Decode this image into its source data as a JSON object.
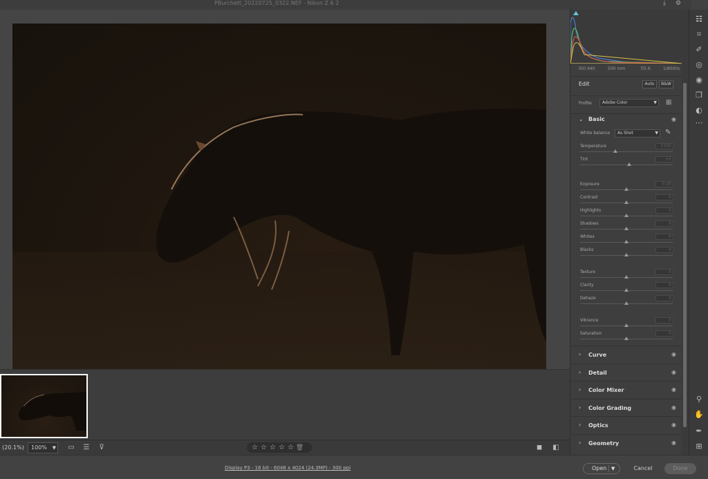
{
  "titlebar": {
    "title": "PBurchett_20220725_0322.NEF  -  Nikon Z 6 2"
  },
  "histogram": {
    "colors": {
      "red": "#d9534f",
      "green": "#5cb85c",
      "blue": "#4a7fd4",
      "yellow": "#d9c24a"
    }
  },
  "exif": {
    "iso": "ISO 640",
    "focal": "500 mm",
    "aperture": "f/5.6",
    "shutter": "1/8000s"
  },
  "edit": {
    "label": "Edit",
    "auto_label": "Auto",
    "bw_label": "B&W"
  },
  "profile": {
    "label": "Profile",
    "value": "Adobe Color"
  },
  "basic": {
    "label": "Basic",
    "white_balance": {
      "label": "White balance",
      "value": "As Shot"
    },
    "sliders": [
      {
        "label": "Temperature",
        "value": "5700",
        "pos": 0.38
      },
      {
        "label": "Tint",
        "value": "+5",
        "pos": 0.53
      },
      {
        "label": "Exposure",
        "value": "0.00",
        "pos": 0.5
      },
      {
        "label": "Contrast",
        "value": "0",
        "pos": 0.5
      },
      {
        "label": "Highlights",
        "value": "0",
        "pos": 0.5
      },
      {
        "label": "Shadows",
        "value": "0",
        "pos": 0.5
      },
      {
        "label": "Whites",
        "value": "0",
        "pos": 0.5
      },
      {
        "label": "Blacks",
        "value": "0",
        "pos": 0.5
      },
      {
        "label": "Texture",
        "value": "0",
        "pos": 0.5
      },
      {
        "label": "Clarity",
        "value": "0",
        "pos": 0.5
      },
      {
        "label": "Dehaze",
        "value": "0",
        "pos": 0.5
      },
      {
        "label": "Vibrance",
        "value": "0",
        "pos": 0.5
      },
      {
        "label": "Saturation",
        "value": "0",
        "pos": 0.5
      }
    ]
  },
  "sections": [
    {
      "label": "Curve"
    },
    {
      "label": "Detail"
    },
    {
      "label": "Color Mixer"
    },
    {
      "label": "Color Grading"
    },
    {
      "label": "Optics"
    },
    {
      "label": "Geometry"
    }
  ],
  "bottombar": {
    "zoom_fit": "(20.1%)",
    "zoom_value": "100%",
    "stars": [
      "☆",
      "☆",
      "☆",
      "☆",
      "☆"
    ]
  },
  "status": {
    "info": "Display P3 - 16 bit - 6048 x 4024 (24.3MP) - 300 ppi",
    "open_label": "Open",
    "cancel_label": "Cancel",
    "done_label": "Done"
  }
}
